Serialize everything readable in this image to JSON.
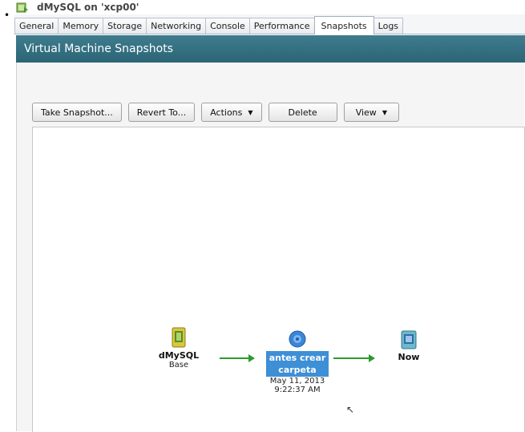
{
  "window": {
    "title": "dMySQL on 'xcp00'"
  },
  "tabs": [
    {
      "label": "General",
      "active": false
    },
    {
      "label": "Memory",
      "active": false
    },
    {
      "label": "Storage",
      "active": false
    },
    {
      "label": "Networking",
      "active": false
    },
    {
      "label": "Console",
      "active": false
    },
    {
      "label": "Performance",
      "active": false
    },
    {
      "label": "Snapshots",
      "active": true
    },
    {
      "label": "Logs",
      "active": false
    }
  ],
  "section": {
    "title": "Virtual Machine Snapshots"
  },
  "toolbar": {
    "take_snapshot": "Take Snapshot...",
    "revert_to": "Revert To...",
    "actions": "Actions",
    "delete": "Delete",
    "view": "View"
  },
  "tree": {
    "base": {
      "name": "dMySQL",
      "sub": "Base"
    },
    "snapshot": {
      "name_line1": "antes crear",
      "name_line2": "carpeta",
      "date": "May 11, 2013",
      "time": "9:22:37 AM"
    },
    "now": {
      "name": "Now"
    }
  },
  "colors": {
    "header_teal": "#2b6576",
    "arrow_green": "#2e9a2e",
    "selection_blue": "#3d8fd6"
  }
}
